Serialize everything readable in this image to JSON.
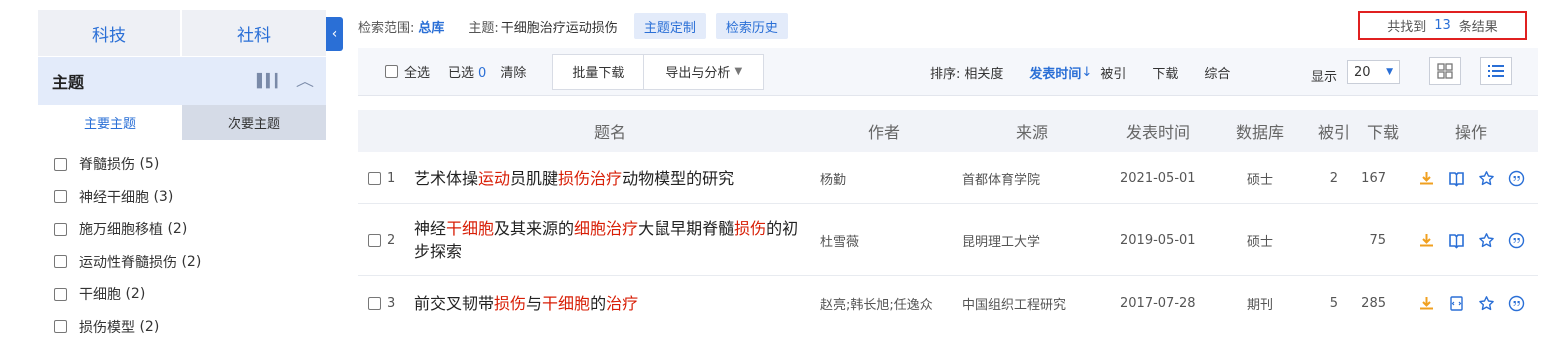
{
  "sidebar": {
    "discipline_tabs": [
      "科技",
      "社科"
    ],
    "facet_title": "主题",
    "sub_tabs": [
      "主要主题",
      "次要主题"
    ],
    "facet_items": [
      {
        "label": "脊髓损伤",
        "count": "(5)"
      },
      {
        "label": "神经干细胞",
        "count": "(3)"
      },
      {
        "label": "施万细胞移植",
        "count": "(2)"
      },
      {
        "label": "运动性脊髓损伤",
        "count": "(2)"
      },
      {
        "label": "干细胞",
        "count": "(2)"
      },
      {
        "label": "损伤模型",
        "count": "(2)"
      }
    ]
  },
  "collapse_icon": "chevron-left",
  "infobar": {
    "scope_label": "检索范围:",
    "scope_value": "总库",
    "topic_label": "主题:",
    "topic_value": "干细胞治疗运动损伤",
    "custom_button": "主题定制",
    "history_button": "检索历史"
  },
  "results": {
    "prefix": "共找到",
    "count": "13",
    "suffix": "条结果"
  },
  "toolbar": {
    "select_all": "全选",
    "selected_label": "已选",
    "selected_count": "0",
    "clear": "清除",
    "batch_download": "批量下载",
    "export": "导出与分析",
    "sort_label": "排序:",
    "sort_options": [
      "相关度",
      "发表时间",
      "被引",
      "下载",
      "综合"
    ],
    "sort_active": "发表时间",
    "sort_arrow": "↓",
    "show_label": "显示",
    "page_size": "20"
  },
  "table": {
    "headers": [
      "题名",
      "作者",
      "来源",
      "发表时间",
      "数据库",
      "被引",
      "下载",
      "操作"
    ],
    "rows": [
      {
        "index": "1",
        "title_parts": [
          {
            "t": "艺术体操",
            "h": false
          },
          {
            "t": "运动",
            "h": true
          },
          {
            "t": "员肌腱",
            "h": false
          },
          {
            "t": "损伤治疗",
            "h": true
          },
          {
            "t": "动物模型的研究",
            "h": false
          }
        ],
        "author": "杨勤",
        "source": "首都体育学院",
        "date": "2021-05-01",
        "database": "硕士",
        "cited": "2",
        "downloads": "167",
        "ops": [
          "download-icon",
          "read-icon",
          "favorite-icon",
          "quote-icon"
        ]
      },
      {
        "index": "2",
        "title_parts": [
          {
            "t": "神经",
            "h": false
          },
          {
            "t": "干细胞",
            "h": true
          },
          {
            "t": "及其来源的",
            "h": false
          },
          {
            "t": "细胞治疗",
            "h": true
          },
          {
            "t": "大鼠早期脊髓",
            "h": false
          },
          {
            "t": "损伤",
            "h": true
          },
          {
            "t": "的初步探索",
            "h": false
          }
        ],
        "author": "杜雪薇",
        "source": "昆明理工大学",
        "date": "2019-05-01",
        "database": "硕士",
        "cited": "",
        "downloads": "75",
        "ops": [
          "download-icon",
          "read-icon",
          "favorite-icon",
          "quote-icon"
        ]
      },
      {
        "index": "3",
        "title_parts": [
          {
            "t": "前交叉韧带",
            "h": false
          },
          {
            "t": "损伤",
            "h": true
          },
          {
            "t": "与",
            "h": false
          },
          {
            "t": "干细胞",
            "h": true
          },
          {
            "t": "的",
            "h": false
          },
          {
            "t": "治疗",
            "h": true
          }
        ],
        "author": "赵亮;韩长旭;任逸众",
        "source": "中国组织工程研究",
        "date": "2017-07-28",
        "database": "期刊",
        "cited": "5",
        "downloads": "285",
        "ops": [
          "download-icon",
          "html-icon",
          "favorite-icon",
          "quote-icon"
        ]
      }
    ]
  },
  "colors": {
    "accent": "#2a6fd6",
    "highlight": "#d81e06",
    "download_icon": "#f0a020",
    "result_box_border": "#e02020"
  }
}
